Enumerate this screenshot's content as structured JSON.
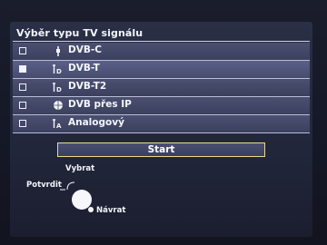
{
  "title": "Výběr typu TV signálu",
  "items": [
    {
      "label": "DVB-C",
      "checked": false,
      "icon": "cable-icon"
    },
    {
      "label": "DVB-T",
      "checked": true,
      "icon": "antenna-td-icon"
    },
    {
      "label": "DVB-T2",
      "checked": false,
      "icon": "antenna-td-icon"
    },
    {
      "label": "DVB přes IP",
      "checked": false,
      "icon": "ip-globe-icon"
    },
    {
      "label": "Analogový",
      "checked": false,
      "icon": "antenna-ta-icon"
    }
  ],
  "start_label": "Start",
  "hints": {
    "select": "Vybrat",
    "confirm": "Potvrdit",
    "back": "Návrat"
  },
  "colors": {
    "panel": "#22263a",
    "row": "#434866",
    "focus_border": "#e9d98a",
    "text": "#f4f6fc"
  }
}
